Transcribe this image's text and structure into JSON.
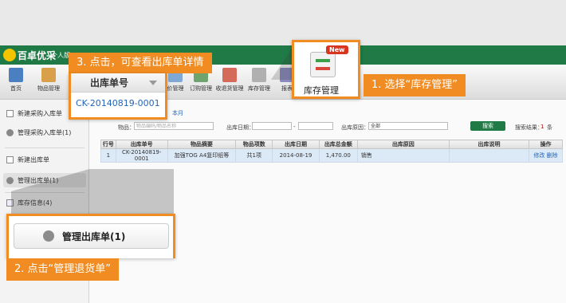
{
  "app": {
    "brand": "百卓优采",
    "edition": "个人版"
  },
  "toolbar": {
    "items": [
      {
        "label": "首页",
        "icon": "home-icon"
      },
      {
        "label": "物品管理",
        "icon": "box-icon"
      },
      {
        "label": "价管理",
        "icon": "price-icon"
      },
      {
        "label": "订购管理",
        "icon": "order-icon"
      },
      {
        "label": "收退货管理",
        "icon": "return-icon"
      },
      {
        "label": "库存管理",
        "icon": "inventory-icon"
      },
      {
        "label": "报表",
        "icon": "report-icon"
      }
    ],
    "new_badge": "New"
  },
  "sidebar": {
    "items": [
      {
        "label": "新建采购入库单",
        "icon": "new-doc-icon"
      },
      {
        "label": "管理采购入库单(1)",
        "icon": "gear-icon"
      },
      {
        "label": "新建出库单",
        "icon": "new-doc-icon"
      },
      {
        "label": "管理出库单(1)",
        "icon": "gear-icon"
      },
      {
        "label": "库存信息(4)",
        "icon": "stock-info-icon"
      }
    ]
  },
  "filters": {
    "month_link": "本月",
    "item_label": "物品：",
    "item_placeholder": "物品编码/物品名称",
    "date_label": "出库日期：",
    "date_sep": "-",
    "reason_label": "出库原因：",
    "reason_value": "全部",
    "search_button": "搜索",
    "result_label": "搜索结果：",
    "result_count": "1",
    "result_unit": "条"
  },
  "table": {
    "columns": [
      "行号",
      "出库单号",
      "物品摘要",
      "物品项数",
      "出库日期",
      "出库总金额",
      "出库原因",
      "出库说明",
      "操作"
    ],
    "rows": [
      {
        "no": "1",
        "order": "CK-20140819-0001",
        "summary": "加强TOG A4复印纸等",
        "count": "共1项",
        "date": "2014-08-19",
        "amount": "1,470.00",
        "reason": "销售",
        "note": "",
        "edit": "修改",
        "del": "删除"
      }
    ]
  },
  "callouts": {
    "step1": "1. 选择“库存管理”",
    "step2": "2. 点击“管理退货单”",
    "step3": "3. 点击，可查看出库单详情",
    "zoom_toolbar_label": "库存管理",
    "zoom_toolbar_badge": "New",
    "zoom_column_header": "出库单号",
    "zoom_order_id": "CK-20140819-0001",
    "zoom_sidebar_label": "管理出库单(1)"
  },
  "colors": {
    "accent": "#f08c21",
    "brand_green": "#1f7a45",
    "link": "#2266bb"
  }
}
